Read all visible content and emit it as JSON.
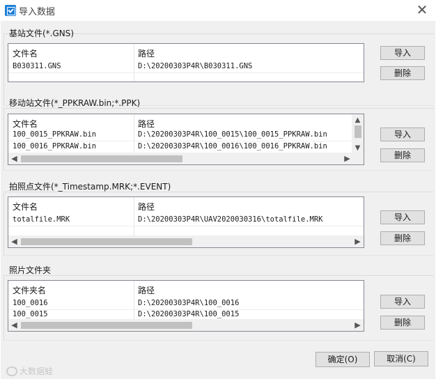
{
  "window": {
    "title": "导入数据",
    "close_label": "✕"
  },
  "columns": {
    "file_name": "文件名",
    "folder_name": "文件夹名",
    "path": "路径"
  },
  "buttons": {
    "import": "导入",
    "delete": "删除",
    "ok": "确定(O)",
    "cancel": "取消(C)"
  },
  "sections": {
    "base": {
      "title": "基站文件(*.GNS)",
      "rows": [
        {
          "name": "B030311.GNS",
          "path": "D:\\20200303P4R\\B030311.GNS"
        }
      ]
    },
    "rover": {
      "title": "移动站文件(*_PPKRAW.bin;*.PPK)",
      "rows": [
        {
          "name": "100_0015_PPKRAW.bin",
          "path": "D:\\20200303P4R\\100_0015\\100_0015_PPKRAW.bin"
        },
        {
          "name": "100_0016_PPKRAW.bin",
          "path": "D:\\20200303P4R\\100_0016\\100_0016_PPKRAW.bin"
        }
      ]
    },
    "photo_points": {
      "title": "拍照点文件(*_Timestamp.MRK;*.EVENT)",
      "rows": [
        {
          "name": "totalfile.MRK",
          "path": "D:\\20200303P4R\\UAV2020030316\\totalfile.MRK"
        }
      ]
    },
    "photo_folder": {
      "title": "照片文件夹",
      "rows": [
        {
          "name": "100_0016",
          "path": "D:\\20200303P4R\\100_0016"
        },
        {
          "name": "100_0015",
          "path": "D:\\20200303P4R\\100_0015"
        }
      ]
    }
  },
  "watermark": "大数据蛙"
}
